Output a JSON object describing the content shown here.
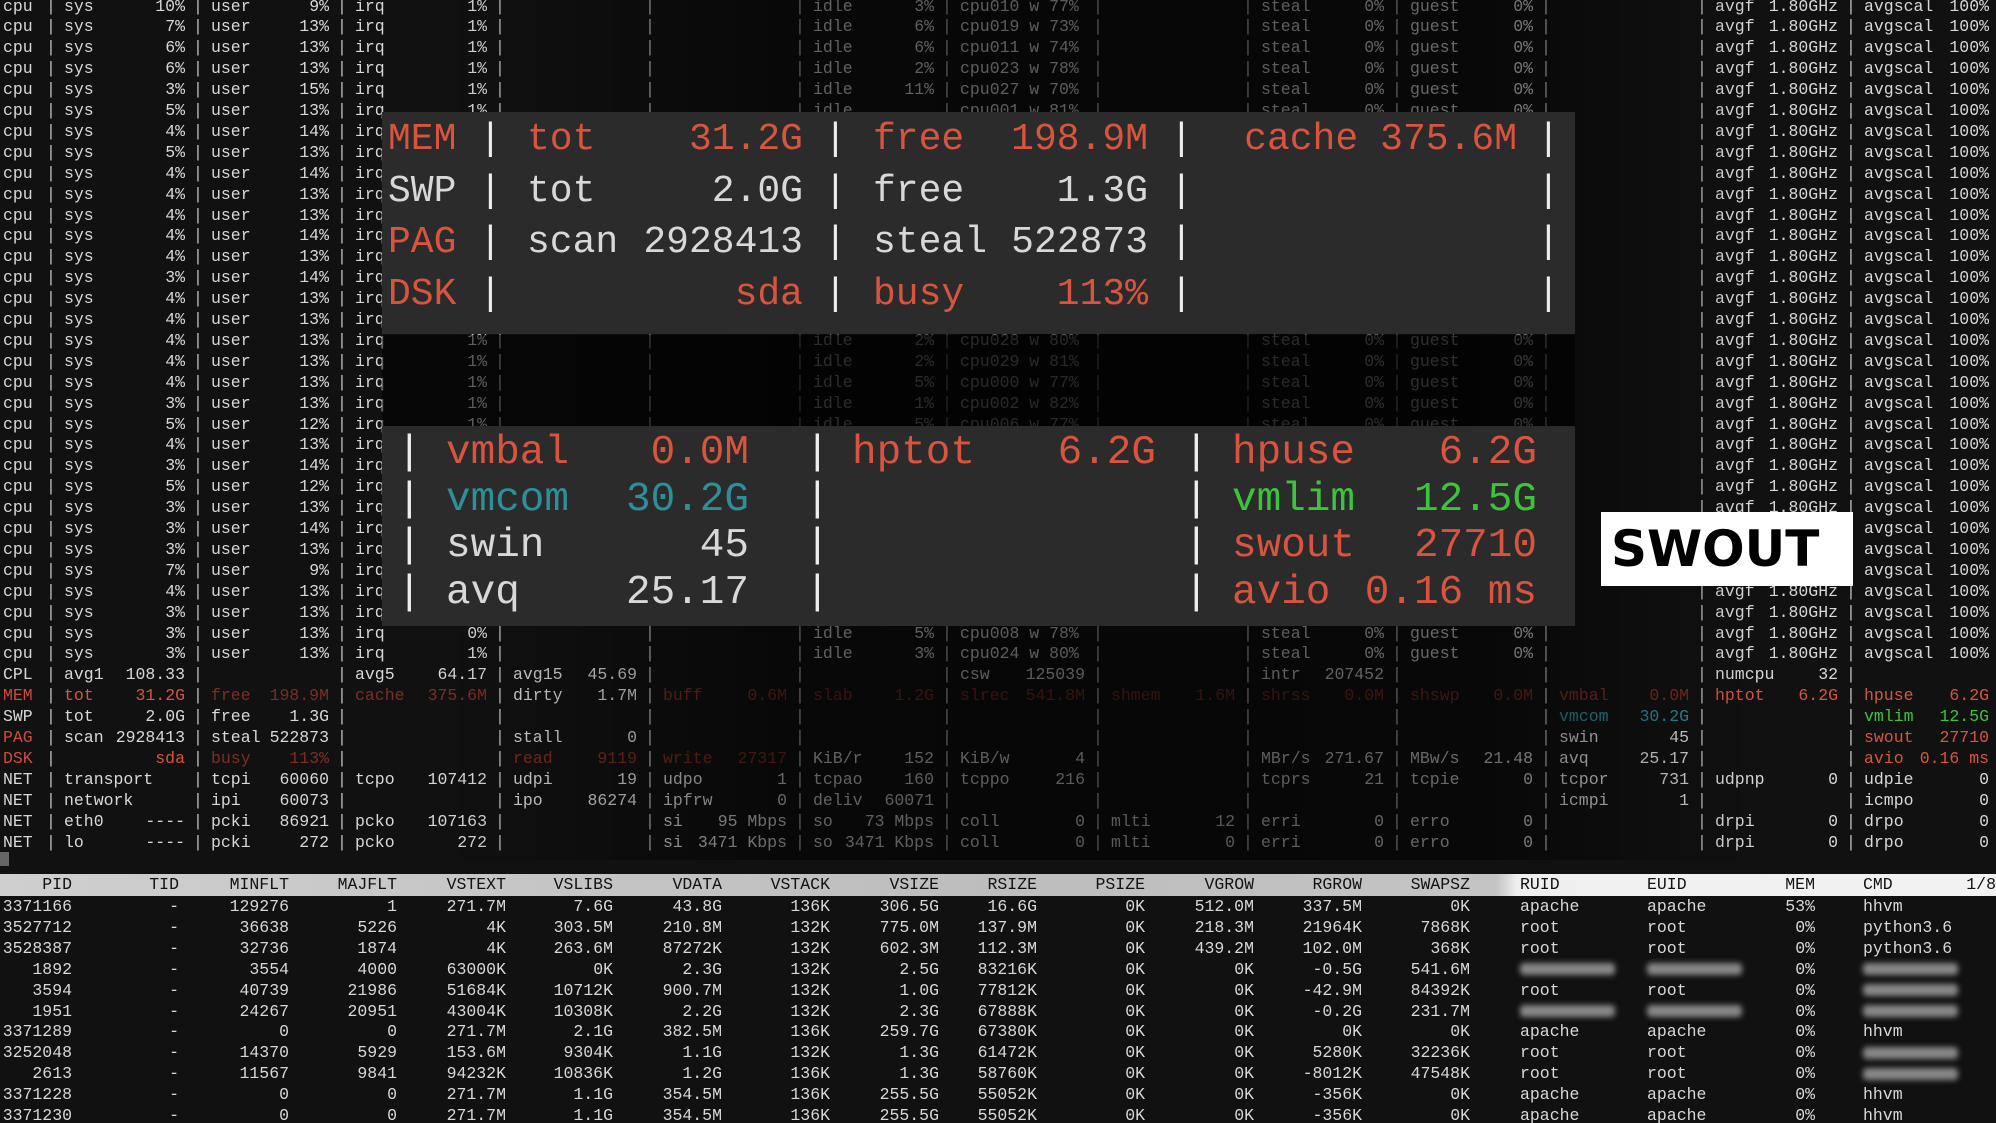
{
  "cpu_label": "cpu",
  "cpu_field_labels": {
    "sys": "sys",
    "user": "user",
    "irq": "irq",
    "idle": "idle",
    "steal": "steal",
    "guest": "guest",
    "avgf": "avgf",
    "avgscal": "avgscal"
  },
  "cpu_rows": [
    {
      "sys": "10%",
      "user": "9%",
      "irq": "1%",
      "idle": "3%",
      "core": "cpu010 w 77%",
      "steal": "0%",
      "guest": "0%",
      "avgf": "1.80GHz",
      "avgscal": "100%"
    },
    {
      "sys": "7%",
      "user": "13%",
      "irq": "1%",
      "idle": "6%",
      "core": "cpu019 w 73%",
      "steal": "0%",
      "guest": "0%",
      "avgf": "1.80GHz",
      "avgscal": "100%"
    },
    {
      "sys": "6%",
      "user": "13%",
      "irq": "1%",
      "idle": "6%",
      "core": "cpu011 w 74%",
      "steal": "0%",
      "guest": "0%",
      "avgf": "1.80GHz",
      "avgscal": "100%"
    },
    {
      "sys": "6%",
      "user": "13%",
      "irq": "1%",
      "idle": "2%",
      "core": "cpu023 w 78%",
      "steal": "0%",
      "guest": "0%",
      "avgf": "1.80GHz",
      "avgscal": "100%"
    },
    {
      "sys": "3%",
      "user": "15%",
      "irq": "1%",
      "idle": "11%",
      "core": "cpu027 w 70%",
      "steal": "0%",
      "guest": "0%",
      "avgf": "1.80GHz",
      "avgscal": "100%"
    },
    {
      "sys": "5%",
      "user": "13%",
      "irq": "1%",
      "idle": null,
      "core": "cpu001 w 81%",
      "steal": "0%",
      "guest": "0%",
      "avgf": "1.80GHz",
      "avgscal": "100%"
    },
    {
      "sys": "4%",
      "user": "14%",
      "avgf": "1.80GHz",
      "avgscal": "100%"
    },
    {
      "sys": "5%",
      "user": "13%",
      "avgf": "1.80GHz",
      "avgscal": "100%"
    },
    {
      "sys": "4%",
      "user": "14%",
      "avgf": "1.80GHz",
      "avgscal": "100%"
    },
    {
      "sys": "4%",
      "user": "13%",
      "avgf": "1.80GHz",
      "avgscal": "100%"
    },
    {
      "sys": "4%",
      "user": "13%",
      "avgf": "1.80GHz",
      "avgscal": "100%"
    },
    {
      "sys": "4%",
      "user": "14%",
      "avgf": "1.80GHz",
      "avgscal": "100%"
    },
    {
      "sys": "4%",
      "user": "13%",
      "avgf": "1.80GHz",
      "avgscal": "100%"
    },
    {
      "sys": "3%",
      "user": "14%",
      "avgf": "1.80GHz",
      "avgscal": "100%"
    },
    {
      "sys": "4%",
      "user": "13%",
      "avgf": "1.80GHz",
      "avgscal": "100%"
    },
    {
      "sys": "4%",
      "user": "13%",
      "avgf": "1.80GHz",
      "avgscal": "100%"
    },
    {
      "sys": "4%",
      "user": "13%",
      "irq": "1%",
      "idle": "2%",
      "core": "cpu028 w 80%",
      "steal": "0%",
      "guest": "0%",
      "avgf": "1.80GHz",
      "avgscal": "100%"
    },
    {
      "sys": "4%",
      "user": "13%",
      "irq": "1%",
      "idle": "2%",
      "core": "cpu029 w 81%",
      "steal": "0%",
      "guest": "0%",
      "avgf": "1.80GHz",
      "avgscal": "100%"
    },
    {
      "sys": "4%",
      "user": "13%",
      "irq": "1%",
      "idle": "5%",
      "core": "cpu000 w 77%",
      "steal": "0%",
      "guest": "0%",
      "avgf": "1.80GHz",
      "avgscal": "100%"
    },
    {
      "sys": "3%",
      "user": "13%",
      "irq": "1%",
      "idle": "1%",
      "core": "cpu002 w 82%",
      "steal": "0%",
      "guest": "0%",
      "avgf": "1.80GHz",
      "avgscal": "100%"
    },
    {
      "sys": "5%",
      "user": "12%",
      "irq": "1%",
      "idle": "5%",
      "core": "cpu006 w 77%",
      "steal": "0%",
      "guest": "0%",
      "avgf": "1.80GHz",
      "avgscal": "100%"
    },
    {
      "sys": "4%",
      "user": "13%",
      "avgf": "1.80GHz",
      "avgscal": "100%"
    },
    {
      "sys": "3%",
      "user": "14%",
      "avgf": "1.80GHz",
      "avgscal": "100%"
    },
    {
      "sys": "5%",
      "user": "12%",
      "avgf": "1.80GHz",
      "avgscal": "100%"
    },
    {
      "sys": "3%",
      "user": "13%",
      "avgf": "1.80GHz",
      "avgscal": "100%"
    },
    {
      "sys": "3%",
      "user": "14%",
      "avgf": "1.80GHz",
      "avgscal": "100%"
    },
    {
      "sys": "3%",
      "user": "13%",
      "avgf": "1.80GHz",
      "avgscal": "100%"
    },
    {
      "sys": "7%",
      "user": "9%",
      "avgf": "1.80GHz",
      "avgscal": "100%"
    },
    {
      "sys": "4%",
      "user": "13%",
      "avgf": "1.80GHz",
      "avgscal": "100%"
    },
    {
      "sys": "3%",
      "user": "13%",
      "avgf": "1.80GHz",
      "avgscal": "100%"
    },
    {
      "sys": "3%",
      "user": "13%",
      "irq": "0%",
      "idle": "5%",
      "core": "cpu008 w 78%",
      "steal": "0%",
      "guest": "0%",
      "avgf": "1.80GHz",
      "avgscal": "100%"
    },
    {
      "sys": "3%",
      "user": "13%",
      "irq": "1%",
      "idle": "3%",
      "core": "cpu024 w 80%",
      "steal": "0%",
      "guest": "0%",
      "avgf": "1.80GHz",
      "avgscal": "100%"
    }
  ],
  "system_rows": [
    {
      "tag": "CPL",
      "tone": "",
      "cells": [
        {
          "col": 1,
          "label": "avg1",
          "value": "108.33"
        },
        {
          "col": 3,
          "label": "avg5",
          "value": "64.17"
        },
        {
          "col": 4,
          "label": "avg15",
          "value": "45.69"
        },
        {
          "col": 7,
          "label": "csw",
          "value": "125039"
        },
        {
          "col": 9,
          "label": "intr",
          "value": "207452"
        },
        {
          "col": 12,
          "label": "numcpu",
          "value": "32"
        }
      ]
    },
    {
      "tag": "MEM",
      "tone": "redtag",
      "cells": [
        {
          "col": 1,
          "label": "tot",
          "value": "31.2G",
          "tone": "red"
        },
        {
          "col": 2,
          "label": "free",
          "value": "198.9M",
          "tone": "dimred"
        },
        {
          "col": 3,
          "label": "cache",
          "value": "375.6M",
          "tone": "dimred"
        },
        {
          "col": 4,
          "label": "dirty",
          "value": "1.7M"
        },
        {
          "col": 5,
          "label": "buff",
          "value": "0.6M",
          "tone": "dimred"
        },
        {
          "col": 6,
          "label": "slab",
          "value": "1.2G",
          "tone": "dimred"
        },
        {
          "col": 7,
          "label": "slrec",
          "value": "541.8M",
          "tone": "dimred"
        },
        {
          "col": 8,
          "label": "shmem",
          "value": "1.6M",
          "tone": "dimred"
        },
        {
          "col": 9,
          "label": "shrss",
          "value": "0.0M",
          "tone": "dimred"
        },
        {
          "col": 10,
          "label": "shswp",
          "value": "0.0M",
          "tone": "dimred"
        },
        {
          "col": 11,
          "label": "vmbal",
          "value": "0.0M",
          "tone": "dimred"
        },
        {
          "col": 12,
          "label": "hptot",
          "value": "6.2G",
          "tone": "red"
        },
        {
          "col": 13,
          "label": "hpuse",
          "value": "6.2G",
          "tone": "red"
        }
      ]
    },
    {
      "tag": "SWP",
      "tone": "",
      "cells": [
        {
          "col": 1,
          "label": "tot",
          "value": "2.0G"
        },
        {
          "col": 2,
          "label": "free",
          "value": "1.3G"
        },
        {
          "col": 11,
          "label": "vmcom",
          "value": "30.2G",
          "tone": "teal"
        },
        {
          "col": 13,
          "label": "vmlim",
          "value": "12.5G",
          "tone": "green"
        }
      ]
    },
    {
      "tag": "PAG",
      "tone": "redtag",
      "cells": [
        {
          "col": 1,
          "label": "scan",
          "value": "2928413"
        },
        {
          "col": 2,
          "label": "steal",
          "value": "522873"
        },
        {
          "col": 4,
          "label": "stall",
          "value": "0"
        },
        {
          "col": 11,
          "label": "swin",
          "value": "45"
        },
        {
          "col": 13,
          "label": "swout",
          "value": "27710",
          "tone": "red"
        }
      ]
    },
    {
      "tag": "DSK",
      "tone": "redtag",
      "cells": [
        {
          "col": 1,
          "label": "",
          "value": "sda",
          "tone": "red"
        },
        {
          "col": 2,
          "label": "busy",
          "value": "113%",
          "tone": "dimred"
        },
        {
          "col": 4,
          "label": "read",
          "value": "9119",
          "tone": "dimred"
        },
        {
          "col": 5,
          "label": "write",
          "value": "27317",
          "tone": "dimred"
        },
        {
          "col": 6,
          "label": "KiB/r",
          "value": "152"
        },
        {
          "col": 7,
          "label": "KiB/w",
          "value": "4"
        },
        {
          "col": 9,
          "label": "MBr/s",
          "value": "271.67"
        },
        {
          "col": 10,
          "label": "MBw/s",
          "value": "21.48"
        },
        {
          "col": 11,
          "label": "avq",
          "value": "25.17"
        },
        {
          "col": 13,
          "label": "avio",
          "value": "0.16 ms",
          "tone": "red"
        }
      ]
    },
    {
      "tag": "NET",
      "tone": "",
      "cells": [
        {
          "col": 1,
          "label": "transport",
          "value": ""
        },
        {
          "col": 2,
          "label": "tcpi",
          "value": "60060"
        },
        {
          "col": 3,
          "label": "tcpo",
          "value": "107412"
        },
        {
          "col": 4,
          "label": "udpi",
          "value": "19"
        },
        {
          "col": 5,
          "label": "udpo",
          "value": "1"
        },
        {
          "col": 6,
          "label": "tcpao",
          "value": "160"
        },
        {
          "col": 7,
          "label": "tcppo",
          "value": "216"
        },
        {
          "col": 9,
          "label": "tcprs",
          "value": "21"
        },
        {
          "col": 10,
          "label": "tcpie",
          "value": "0"
        },
        {
          "col": 11,
          "label": "tcpor",
          "value": "731"
        },
        {
          "col": 12,
          "label": "udpnp",
          "value": "0"
        },
        {
          "col": 13,
          "label": "udpie",
          "value": "0"
        }
      ]
    },
    {
      "tag": "NET",
      "tone": "",
      "cells": [
        {
          "col": 1,
          "label": "network",
          "value": ""
        },
        {
          "col": 2,
          "label": "ipi",
          "value": "60073"
        },
        {
          "col": 4,
          "label": "ipo",
          "value": "86274"
        },
        {
          "col": 5,
          "label": "ipfrw",
          "value": "0"
        },
        {
          "col": 6,
          "label": "deliv",
          "value": "60071"
        },
        {
          "col": 11,
          "label": "icmpi",
          "value": "1"
        },
        {
          "col": 13,
          "label": "icmpo",
          "value": "0"
        }
      ]
    },
    {
      "tag": "NET",
      "tone": "",
      "cells": [
        {
          "col": 1,
          "label": "eth0",
          "value": "----"
        },
        {
          "col": 2,
          "label": "pcki",
          "value": "86921"
        },
        {
          "col": 3,
          "label": "pcko",
          "value": "107163"
        },
        {
          "col": 5,
          "label": "si",
          "value": "95 Mbps"
        },
        {
          "col": 6,
          "label": "so",
          "value": "73 Mbps"
        },
        {
          "col": 7,
          "label": "coll",
          "value": "0"
        },
        {
          "col": 8,
          "label": "mlti",
          "value": "12"
        },
        {
          "col": 9,
          "label": "erri",
          "value": "0"
        },
        {
          "col": 10,
          "label": "erro",
          "value": "0"
        },
        {
          "col": 12,
          "label": "drpi",
          "value": "0"
        },
        {
          "col": 13,
          "label": "drpo",
          "value": "0"
        }
      ]
    },
    {
      "tag": "NET",
      "tone": "",
      "cells": [
        {
          "col": 1,
          "label": "lo",
          "value": "----"
        },
        {
          "col": 2,
          "label": "pcki",
          "value": "272"
        },
        {
          "col": 3,
          "label": "pcko",
          "value": "272"
        },
        {
          "col": 5,
          "label": "si",
          "value": "3471 Kbps"
        },
        {
          "col": 6,
          "label": "so",
          "value": "3471 Kbps"
        },
        {
          "col": 7,
          "label": "coll",
          "value": "0"
        },
        {
          "col": 8,
          "label": "mlti",
          "value": "0"
        },
        {
          "col": 9,
          "label": "erri",
          "value": "0"
        },
        {
          "col": 10,
          "label": "erro",
          "value": "0"
        },
        {
          "col": 12,
          "label": "drpi",
          "value": "0"
        },
        {
          "col": 13,
          "label": "drpo",
          "value": "0"
        }
      ]
    }
  ],
  "zoom_memory": {
    "rows": [
      {
        "tag": "MEM",
        "tag_tone": "red",
        "cells": [
          {
            "label": "tot",
            "value": "31.2G",
            "tone": "red"
          },
          {
            "label": "free",
            "value": "198.9M",
            "tone": "red"
          },
          {
            "label": "cache",
            "value": "375.6M",
            "tone": "red"
          }
        ]
      },
      {
        "tag": "SWP",
        "tag_tone": "",
        "cells": [
          {
            "label": "tot",
            "value": "2.0G"
          },
          {
            "label": "free",
            "value": "1.3G"
          },
          null
        ]
      },
      {
        "tag": "PAG",
        "tag_tone": "red",
        "cells": [
          {
            "label": "scan",
            "value": "2928413"
          },
          {
            "label": "steal",
            "value": "522873"
          },
          null
        ]
      },
      {
        "tag": "DSK",
        "tag_tone": "red",
        "cells": [
          {
            "label": "",
            "value": "sda",
            "tone": "red"
          },
          {
            "label": "busy",
            "value": "113%",
            "tone": "red"
          },
          null
        ]
      }
    ]
  },
  "zoom_vm": {
    "rows": [
      [
        {
          "label": "vmbal",
          "value": "0.0M",
          "tone": "red"
        },
        {
          "label": "hptot",
          "value": "6.2G",
          "tone": "red"
        },
        {
          "label": "hpuse",
          "value": "6.2G",
          "tone": "red"
        }
      ],
      [
        {
          "label": "vmcom",
          "value": "30.2G",
          "tone": "teal"
        },
        null,
        {
          "label": "vmlim",
          "value": "12.5G",
          "tone": "green"
        }
      ],
      [
        {
          "label": "swin",
          "value": "45"
        },
        null,
        {
          "label": "swout",
          "value": "27710",
          "tone": "red"
        }
      ],
      [
        {
          "label": "avq",
          "value": "25.17"
        },
        null,
        {
          "label": "avio",
          "value": "0.16 ms",
          "tone": "red"
        }
      ]
    ]
  },
  "callout": {
    "text": "SWOUT"
  },
  "process_table": {
    "headers": [
      "PID",
      "TID",
      "MINFLT",
      "MAJFLT",
      "VSTEXT",
      "VSLIBS",
      "VDATA",
      "VSTACK",
      "VSIZE",
      "RSIZE",
      "PSIZE",
      "VGROW",
      "RGROW",
      "SWAPSZ",
      "RUID",
      "EUID",
      "MEM",
      "CMD"
    ],
    "page": "1/8",
    "rows": [
      [
        "3371166",
        "-",
        "129276",
        "1",
        "271.7M",
        "7.6G",
        "43.8G",
        "136K",
        "306.5G",
        "16.6G",
        "0K",
        "512.0M",
        "337.5M",
        "0K",
        "apache",
        "apache",
        "53%",
        "hhvm"
      ],
      [
        "3527712",
        "-",
        "36638",
        "5226",
        "4K",
        "303.5M",
        "210.8M",
        "132K",
        "775.0M",
        "137.9M",
        "0K",
        "218.3M",
        "21964K",
        "7868K",
        "root",
        "root",
        "0%",
        "python3.6"
      ],
      [
        "3528387",
        "-",
        "32736",
        "1874",
        "4K",
        "263.6M",
        "87272K",
        "132K",
        "602.3M",
        "112.3M",
        "0K",
        "439.2M",
        "102.0M",
        "368K",
        "root",
        "root",
        "0%",
        "python3.6"
      ],
      [
        "1892",
        "-",
        "3554",
        "4000",
        "63000K",
        "0K",
        "2.3G",
        "132K",
        "2.5G",
        "83216K",
        "0K",
        "0K",
        "-0.5G",
        "541.6M",
        null,
        null,
        "0%",
        null
      ],
      [
        "3594",
        "-",
        "40739",
        "21986",
        "51684K",
        "10712K",
        "900.7M",
        "132K",
        "1.0G",
        "77812K",
        "0K",
        "0K",
        "-42.9M",
        "84392K",
        "root",
        "root",
        "0%",
        null
      ],
      [
        "1951",
        "-",
        "24267",
        "20951",
        "43004K",
        "10308K",
        "2.2G",
        "132K",
        "2.3G",
        "67888K",
        "0K",
        "0K",
        "-0.2G",
        "231.7M",
        null,
        null,
        "0%",
        null
      ],
      [
        "3371289",
        "-",
        "0",
        "0",
        "271.7M",
        "2.1G",
        "382.5M",
        "136K",
        "259.7G",
        "67380K",
        "0K",
        "0K",
        "0K",
        "0K",
        "apache",
        "apache",
        "0%",
        "hhvm"
      ],
      [
        "3252048",
        "-",
        "14370",
        "5929",
        "153.6M",
        "9304K",
        "1.1G",
        "132K",
        "1.3G",
        "61472K",
        "0K",
        "0K",
        "5280K",
        "32236K",
        "root",
        "root",
        "0%",
        null
      ],
      [
        "2613",
        "-",
        "11567",
        "9841",
        "94232K",
        "10836K",
        "1.2G",
        "136K",
        "1.3G",
        "58760K",
        "0K",
        "0K",
        "-8012K",
        "47548K",
        "root",
        "root",
        "0%",
        null
      ],
      [
        "3371228",
        "-",
        "0",
        "0",
        "271.7M",
        "1.1G",
        "354.5M",
        "136K",
        "255.5G",
        "55052K",
        "0K",
        "0K",
        "-356K",
        "0K",
        "apache",
        "apache",
        "0%",
        "hhvm"
      ],
      [
        "3371230",
        "-",
        "0",
        "0",
        "271.7M",
        "1.1G",
        "354.5M",
        "136K",
        "255.5G",
        "55052K",
        "0K",
        "0K",
        "-356K",
        "0K",
        "apache",
        "apache",
        "0%",
        "hhvm"
      ]
    ]
  },
  "colors": {
    "red": "#d9543f",
    "dim_red": "#7c2e24",
    "teal": "#3fb8c4",
    "green": "#3cc43c",
    "panel": "#2b2b2b"
  }
}
